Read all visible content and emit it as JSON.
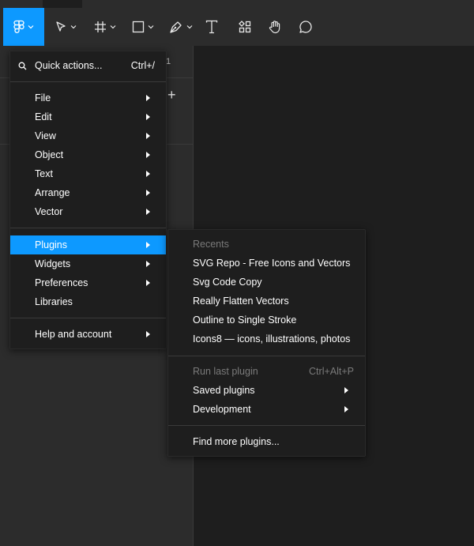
{
  "colors": {
    "accent": "#0d99ff",
    "menu_bg": "#1e1e1e",
    "toolbar_bg": "#2c2c2c",
    "dim_text": "#7a7a7a"
  },
  "toolbar": {
    "tools": [
      {
        "icon": "figma-main-menu-icon",
        "has_chevron": true,
        "active": true
      },
      {
        "icon": "move-pointer-icon",
        "has_chevron": true
      },
      {
        "icon": "frame-icon",
        "has_chevron": true
      },
      {
        "icon": "rectangle-icon",
        "has_chevron": true
      },
      {
        "icon": "pen-icon",
        "has_chevron": true
      },
      {
        "icon": "text-icon"
      },
      {
        "icon": "resources-icon"
      },
      {
        "icon": "hand-icon"
      },
      {
        "icon": "comment-icon"
      }
    ]
  },
  "left_panel": {
    "partial_number": "1",
    "add_icon": "plus-icon"
  },
  "main_menu": {
    "quick_actions": {
      "label": "Quick actions...",
      "shortcut": "Ctrl+/"
    },
    "items": [
      {
        "label": "File",
        "submenu": true
      },
      {
        "label": "Edit",
        "submenu": true
      },
      {
        "label": "View",
        "submenu": true
      },
      {
        "label": "Object",
        "submenu": true
      },
      {
        "label": "Text",
        "submenu": true
      },
      {
        "label": "Arrange",
        "submenu": true
      },
      {
        "label": "Vector",
        "submenu": true
      },
      {
        "label": "Plugins",
        "submenu": true,
        "highlighted": true
      },
      {
        "label": "Widgets",
        "submenu": true
      },
      {
        "label": "Preferences",
        "submenu": true
      },
      {
        "label": "Libraries",
        "submenu": false
      },
      {
        "label": "Help and account",
        "submenu": true
      }
    ]
  },
  "plugins_submenu": {
    "recents_header": "Recents",
    "recents": [
      "SVG Repo - Free Icons and Vectors",
      "Svg Code Copy",
      "Really Flatten Vectors",
      "Outline to Single Stroke",
      "Icons8 — icons, illustrations, photos"
    ],
    "run_last": {
      "label": "Run last plugin",
      "shortcut": "Ctrl+Alt+P"
    },
    "saved_plugins": "Saved plugins",
    "development": "Development",
    "find_more": "Find more plugins..."
  }
}
